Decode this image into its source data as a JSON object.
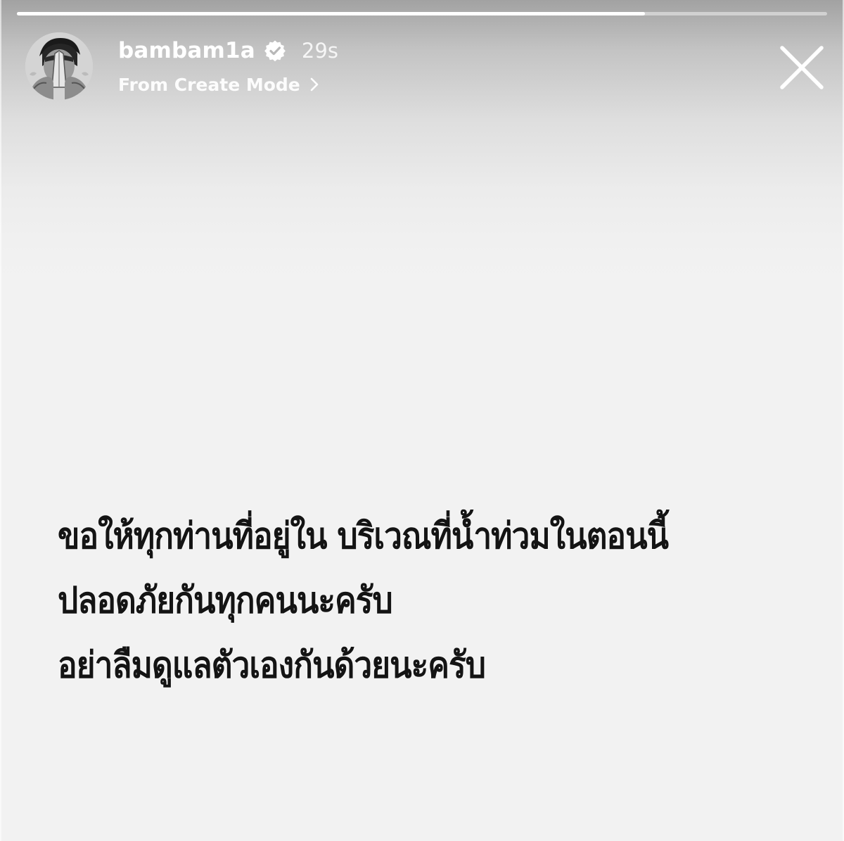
{
  "story": {
    "progress": 0.775,
    "user": {
      "username": "bambam1a",
      "verified": true,
      "avatar_icon": "avatar-prayer-hands",
      "time_ago": "29s"
    },
    "subtitle": "From Create Mode",
    "subtitle_icon": "chevron-right-icon",
    "close_icon": "close-icon",
    "message_lines": [
      "ขอให้ทุกท่านที่อยู่ใน บริเวณที่น้ำท่วมในตอนนี้",
      "ปลอดภัยกันทุกคนนะครับ",
      "อย่าลืมดูแลตัวเองกันด้วยนะครับ"
    ]
  },
  "colors": {
    "text_dark": "#141414",
    "header_text": "#ffffff",
    "background": "#f2f2f2"
  }
}
